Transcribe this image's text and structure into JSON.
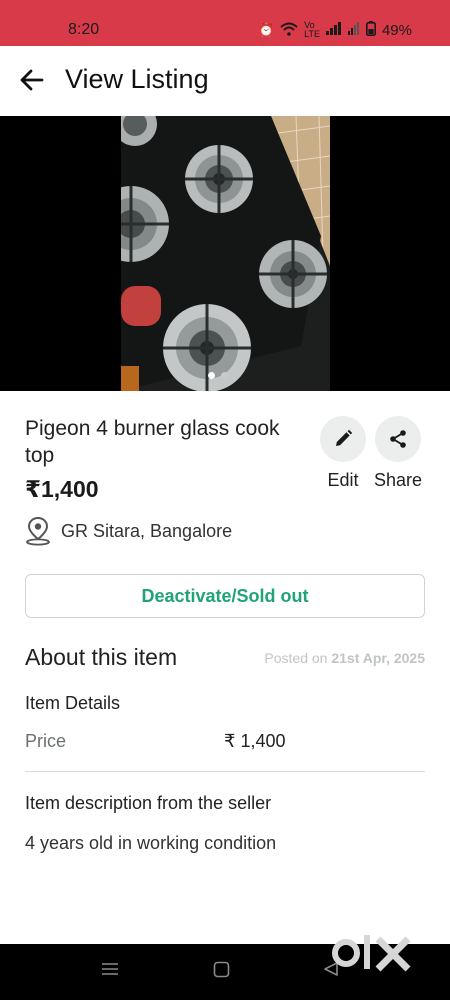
{
  "status_bar": {
    "time": "8:20",
    "battery": "49%"
  },
  "app_bar": {
    "title": "View Listing"
  },
  "listing": {
    "title": "Pigeon 4 burner glass cook top",
    "price": "₹1,400",
    "location": "GR Sitara, Bangalore",
    "image_count": 2,
    "active_image": 1
  },
  "actions": {
    "edit_label": "Edit",
    "share_label": "Share",
    "deactivate_label": "Deactivate/Sold out"
  },
  "about": {
    "heading": "About this item",
    "posted_prefix": "Posted on ",
    "posted_date": "21st Apr, 2025",
    "details_heading": "Item Details",
    "price_label": "Price",
    "price_value": "₹ 1,400",
    "description_heading": "Item description from the seller",
    "description": "4 years old in working condition"
  },
  "watermark": "olx",
  "colors": {
    "status_bar": "#d93a4a",
    "accent_green": "#1fa377"
  }
}
